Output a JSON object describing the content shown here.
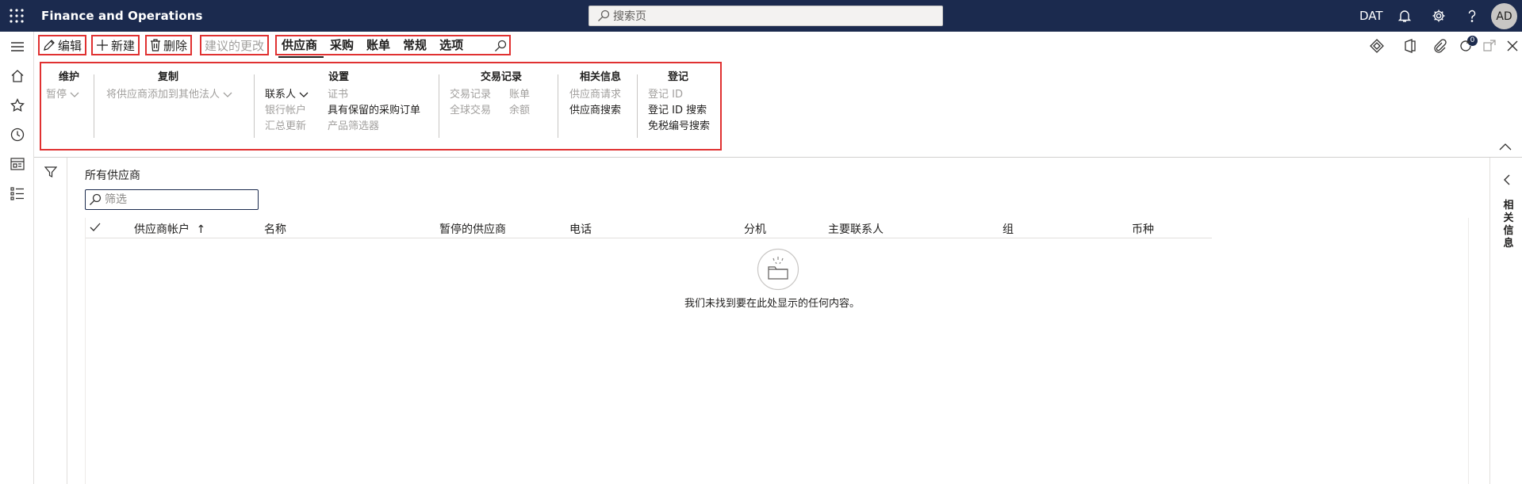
{
  "topbar": {
    "app_title": "Finance and Operations",
    "search_placeholder": "搜索页",
    "company": "DAT",
    "avatar_initials": "AD",
    "bar_color": "#1b2a4e"
  },
  "actions": {
    "edit": "编辑",
    "new": "新建",
    "delete": "删除",
    "suggest_changes": "建议的更改"
  },
  "tabs": [
    "供应商",
    "采购",
    "账单",
    "常规",
    "选项"
  ],
  "active_tab": "供应商",
  "notification_count": "0",
  "ribbon": {
    "maintain": {
      "title": "维护",
      "hold": "暂停"
    },
    "copy": {
      "title": "复制",
      "add_to_legal": "将供应商添加到其他法人"
    },
    "setup": {
      "title": "设置",
      "contacts": "联系人",
      "bank_accounts": "银行帐户",
      "summary_update": "汇总更新",
      "certificates": "证书",
      "held_po": "具有保留的采购订单",
      "product_filter": "产品筛选器"
    },
    "transactions": {
      "title": "交易记录",
      "transactions": "交易记录",
      "global": "全球交易",
      "invoices": "账单",
      "balance": "余额"
    },
    "related": {
      "title": "相关信息",
      "vendor_requests": "供应商请求",
      "vendor_search": "供应商搜索"
    },
    "registration": {
      "title": "登记",
      "reg_id": "登记 ID",
      "reg_id_search": "登记 ID 搜索",
      "tax_exempt_search": "免税编号搜索"
    }
  },
  "content": {
    "view_title": "所有供应商",
    "filter_placeholder": "筛选",
    "columns": [
      "供应商帐户",
      "名称",
      "暂停的供应商",
      "电话",
      "分机",
      "主要联系人",
      "组",
      "币种"
    ],
    "sort_indicator": "↑",
    "empty_message": "我们未找到要在此处显示的任何内容。"
  },
  "right_panel": {
    "label": "相关信息"
  },
  "highlight_color": "#e03131"
}
